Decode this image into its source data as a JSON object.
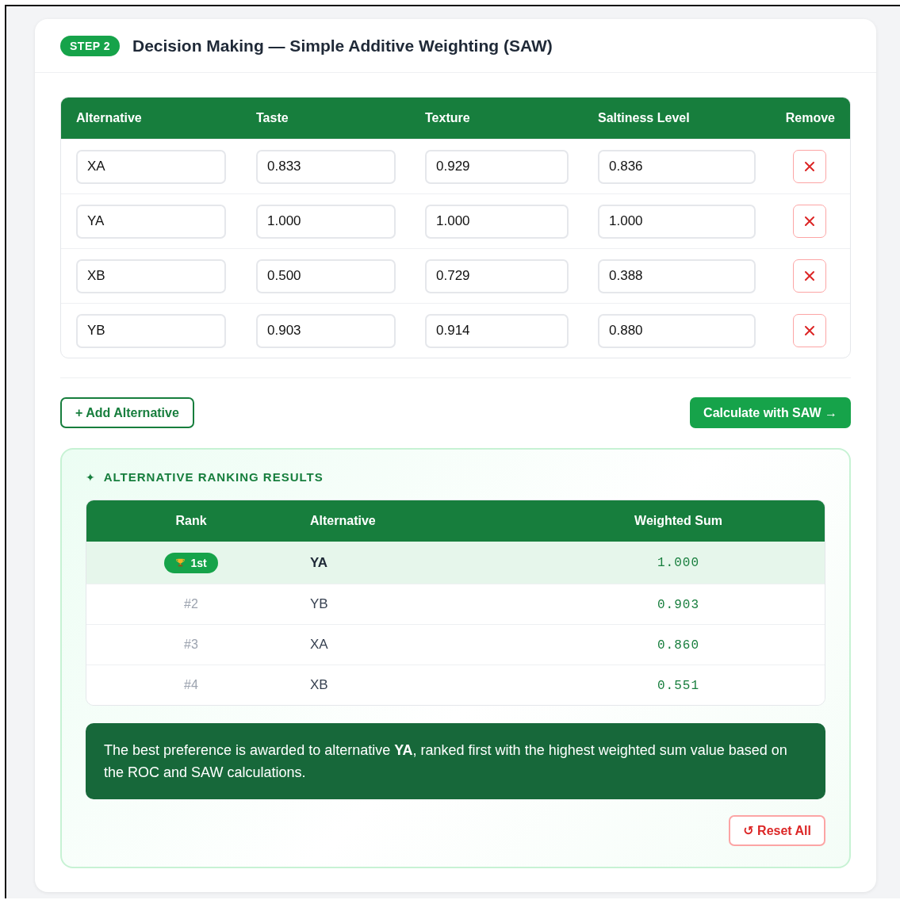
{
  "header": {
    "step_badge": "STEP 2",
    "title": "Decision Making — Simple Additive Weighting (SAW)"
  },
  "criteria_table": {
    "columns": [
      "Alternative",
      "Taste",
      "Texture",
      "Saltiness Level",
      "Remove"
    ],
    "rows": [
      {
        "alternative": "XA",
        "values": [
          "0.833",
          "0.929",
          "0.836"
        ]
      },
      {
        "alternative": "YA",
        "values": [
          "1.000",
          "1.000",
          "1.000"
        ]
      },
      {
        "alternative": "XB",
        "values": [
          "0.500",
          "0.729",
          "0.388"
        ]
      },
      {
        "alternative": "YB",
        "values": [
          "0.903",
          "0.914",
          "0.880"
        ]
      }
    ]
  },
  "actions": {
    "add_button": "+ Add Alternative",
    "calculate_button": "Calculate with SAW →"
  },
  "results": {
    "icon_text": "✦",
    "title": "ALTERNATIVE RANKING RESULTS",
    "columns": [
      "Rank",
      "Alternative",
      "Weighted Sum"
    ],
    "rows": [
      {
        "rank": "1st",
        "alternative": "YA",
        "score": "1.000",
        "selected": true
      },
      {
        "rank": "#2",
        "alternative": "YB",
        "score": "0.903",
        "selected": false
      },
      {
        "rank": "#3",
        "alternative": "XA",
        "score": "0.860",
        "selected": false
      },
      {
        "rank": "#4",
        "alternative": "XB",
        "score": "0.551",
        "selected": false
      }
    ],
    "summary": "The best preference is awarded to alternative **YA**, ranked first with the highest weighted sum value based on the ROC and SAW calculations.",
    "reset_button": "↺ Reset All"
  }
}
